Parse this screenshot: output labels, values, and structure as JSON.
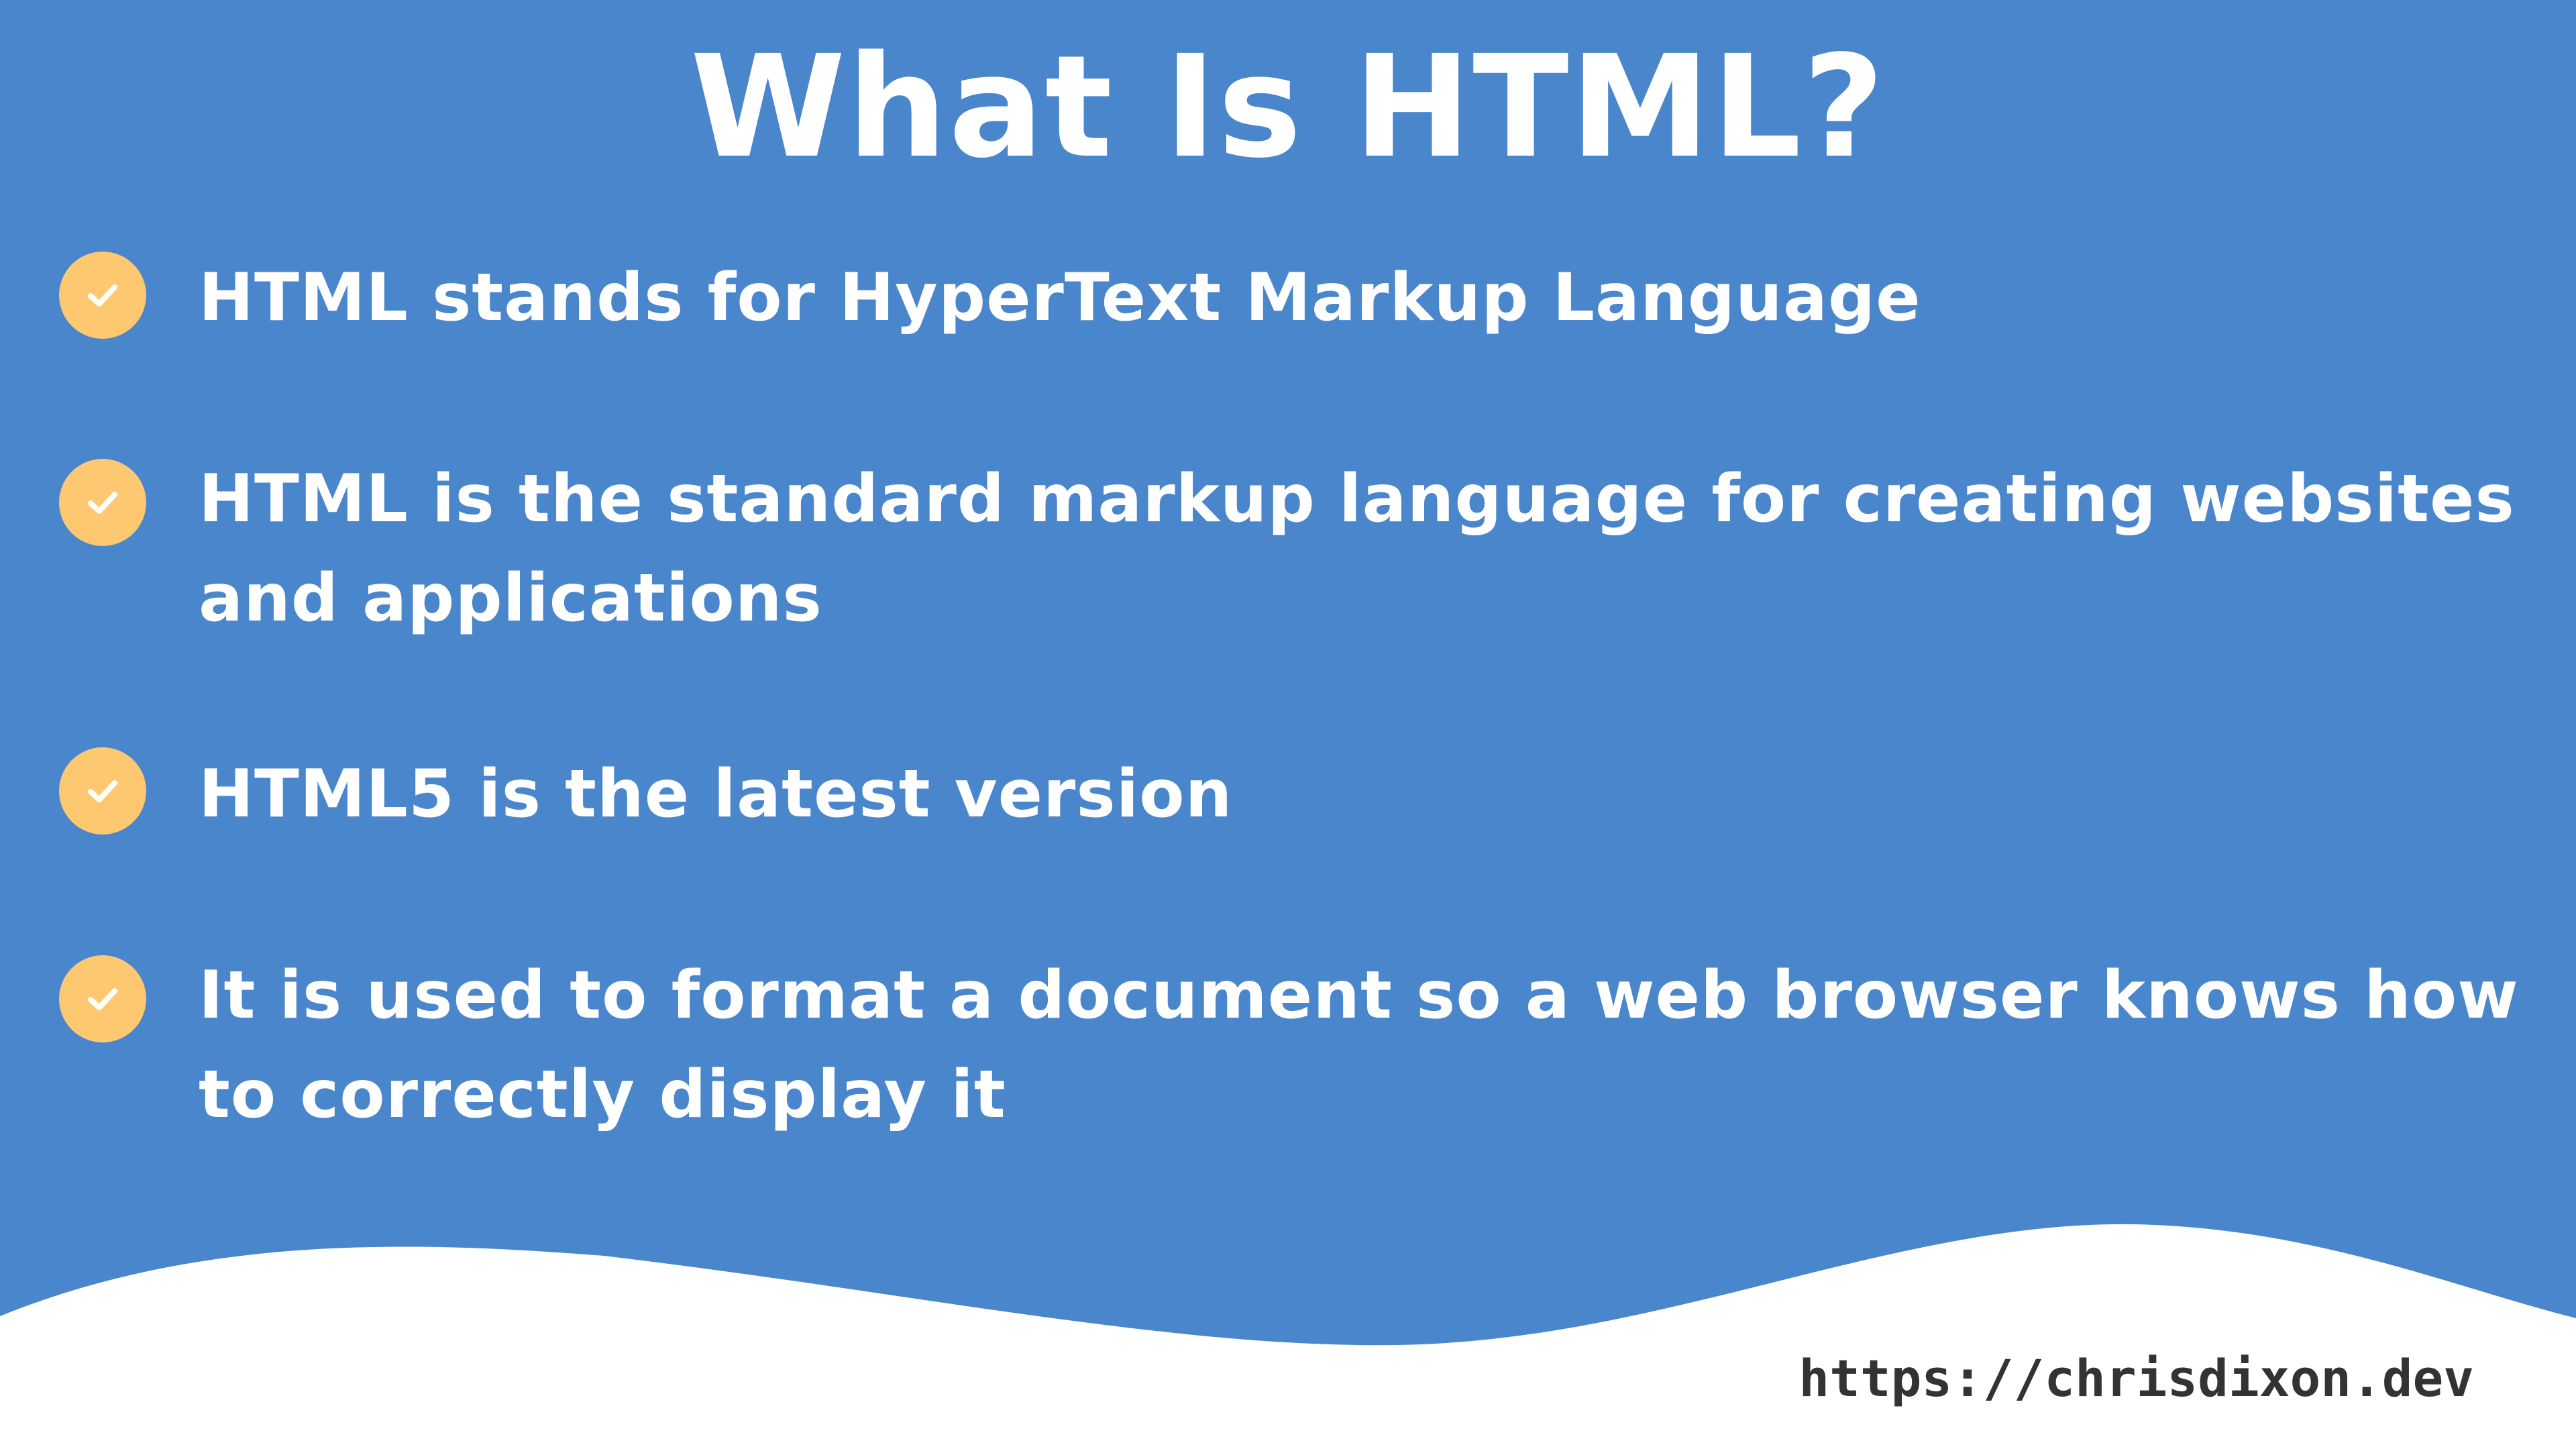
{
  "colors": {
    "background": "#4a86cc",
    "text": "#ffffff",
    "check_badge": "#fdc870",
    "wave": "#ffffff",
    "url_text": "#333333"
  },
  "slide": {
    "title": "What Is HTML?",
    "bullets": [
      {
        "icon": "check-icon",
        "text": "HTML stands for HyperText Markup Language"
      },
      {
        "icon": "check-icon",
        "text": "HTML is the standard markup language for creating websites and applications"
      },
      {
        "icon": "check-icon",
        "text": "HTML5 is the latest version"
      },
      {
        "icon": "check-icon",
        "text": "It is used to format a document so a web browser knows how to correctly display it"
      }
    ]
  },
  "footer": {
    "url": "https://chrisdixon.dev"
  }
}
